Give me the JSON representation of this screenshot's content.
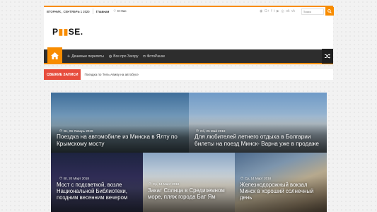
{
  "topbar": {
    "date": "ВТОРНИК , СЕНТЯБРЬ 1 2020",
    "links": [
      "Главная",
      "О Нас"
    ],
    "socials": [
      "rss-icon",
      "google-plus-icon",
      "facebook-icon",
      "twitter-icon",
      "youtube-icon",
      "instagram-icon",
      "odnoklassniki-icon",
      "vk-icon"
    ],
    "search_placeholder": "Поиск"
  },
  "logo": {
    "part1": "P",
    "accent": "▮▮",
    "part2": "SE."
  },
  "nav": {
    "items": [
      {
        "label": "Дешевые перелеты",
        "icon": "plane-icon"
      },
      {
        "label": "Все про Загору",
        "icon": "globe-icon"
      },
      {
        "label": "ФотоPause",
        "icon": "camera-icon"
      }
    ]
  },
  "breaking": {
    "label": "Свежие записи",
    "text": "Поездка по Тель-Авиву на автобусе"
  },
  "posts": [
    {
      "date": "Вс, 06 Январь 2019",
      "title": "Поездка на автомобиле из Минска в Ялту по Крымскому мосту"
    },
    {
      "date": "Сб, 25 Май 2018",
      "title": "Для любителей летнего отдыха в Болгарии билеты на поезд Минск- Варна уже в продаже"
    },
    {
      "date": "Вт, 20 Март 2018",
      "title": "Мост с подсветкой, возле Национальной Библиотеки, поздним весенним вечером"
    },
    {
      "date": "Ср, 14 Март 2018",
      "title": "Закат Солнца в Средиземном море, пляж города Бат Ям"
    },
    {
      "date": "Ср, 14 Март 2018",
      "title": "Железнодорожный вокзал Минск в хороший солнечный день"
    }
  ],
  "colors": {
    "accent": "#f88c00",
    "breaking": "#e74c3c",
    "nav": "#2d2d2d"
  }
}
